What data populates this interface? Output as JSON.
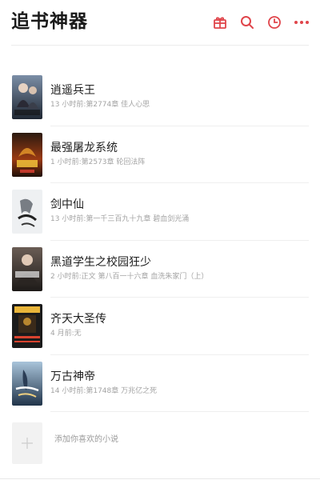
{
  "app": {
    "title": "追书神器"
  },
  "header": {
    "icons": [
      "gift-icon",
      "search-icon",
      "clock-icon",
      "more-icon"
    ],
    "accent_color": "#e0454b"
  },
  "books": [
    {
      "title": "逍遥兵王",
      "meta": "13 小时前:第2774章   佳人心思"
    },
    {
      "title": "最强屠龙系统",
      "meta": "1 小时前:第2573章   轮回法阵"
    },
    {
      "title": "剑中仙",
      "meta": "13 小时前:第一千三百九十九章 碧血剑光涌"
    },
    {
      "title": "黑道学生之校园狂少",
      "meta": "2 小时前:正文 第八百一十六章 血洗朱家门（上）"
    },
    {
      "title": "齐天大圣传",
      "meta": "4 月前:无"
    },
    {
      "title": "万古神帝",
      "meta": "14 小时前:第1748章 万兆亿之死"
    }
  ],
  "add_book": {
    "label": "添加你喜欢的小说"
  }
}
